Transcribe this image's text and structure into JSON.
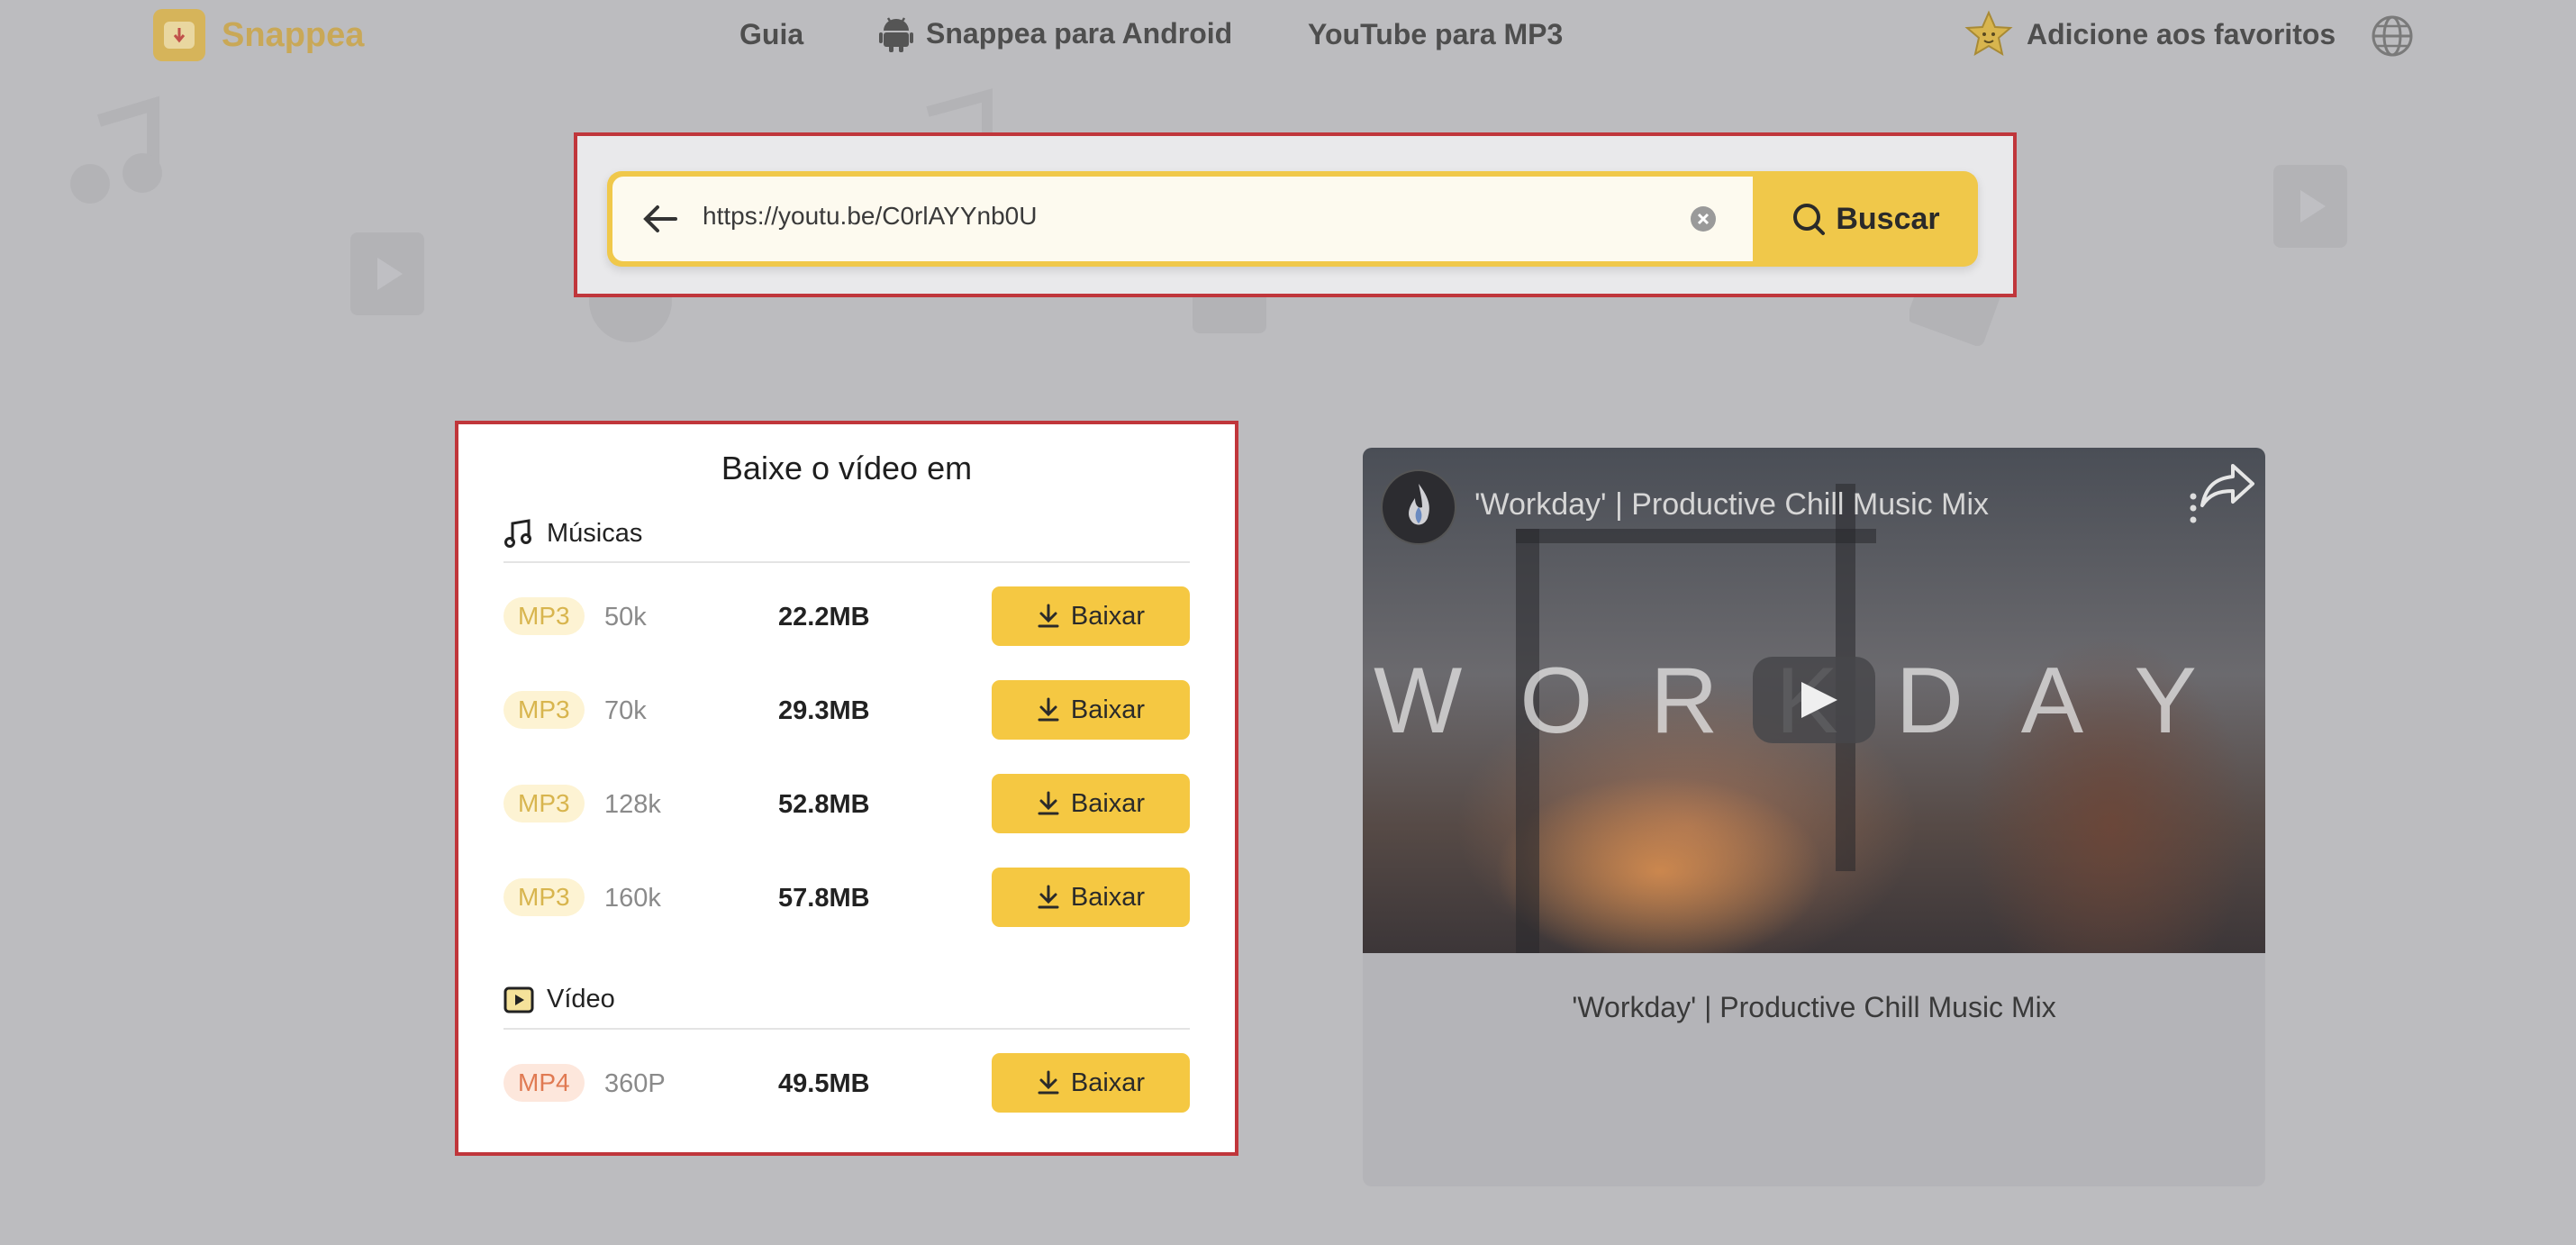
{
  "brand": {
    "name": "Snappea"
  },
  "nav": {
    "guide": "Guia",
    "android": "Snappea para Android",
    "mp3": "YouTube para MP3",
    "favorites": "Adicione aos favoritos"
  },
  "search": {
    "value": "https://youtu.be/C0rlAYYnb0U",
    "button_label": "Buscar"
  },
  "download_panel": {
    "title": "Baixe o vídeo em",
    "music_section_label": "Músicas",
    "video_section_label": "Vídeo",
    "music_rows": [
      {
        "format": "MP3",
        "quality": "50k",
        "size": "22.2MB",
        "button": "Baixar"
      },
      {
        "format": "MP3",
        "quality": "70k",
        "size": "29.3MB",
        "button": "Baixar"
      },
      {
        "format": "MP3",
        "quality": "128k",
        "size": "52.8MB",
        "button": "Baixar"
      },
      {
        "format": "MP3",
        "quality": "160k",
        "size": "57.8MB",
        "button": "Baixar"
      }
    ],
    "video_rows": [
      {
        "format": "MP4",
        "quality": "360P",
        "size": "49.5MB",
        "button": "Baixar"
      }
    ]
  },
  "video": {
    "title": "'Workday' | Productive Chill Music Mix",
    "thumbnail_text": "WORKDAY",
    "caption": "'Workday' | Productive Chill Music Mix"
  },
  "colors": {
    "accent": "#f5c842",
    "highlight_border": "#c0363b",
    "overlay_bg": "#bcbcbf",
    "mp3_badge": "#d8b54e",
    "mp4_badge": "#e07a52"
  }
}
